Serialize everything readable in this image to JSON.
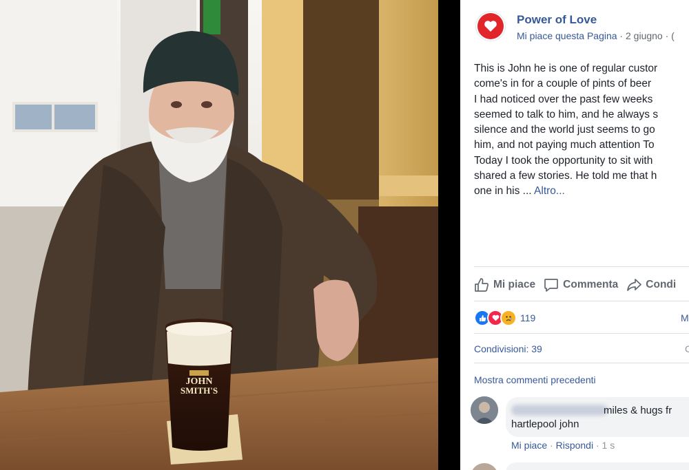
{
  "post": {
    "page_name": "Power of Love",
    "like_page": "Mi piace questa Pagina",
    "separator": " · ",
    "date": "2 giugno",
    "date_tail": " · (",
    "text_lines": [
      "This is John he is one of regular custor",
      "come's in for a couple of pints of beer",
      "I had noticed over the past few weeks",
      "seemed to talk to him, and he always s",
      "silence and the world just seems to go",
      "him, and not paying much attention To",
      "Today I took the opportunity to sit with",
      "shared a few stories. He told me that h"
    ],
    "last_line_prefix": "one in his ... ",
    "more_label": "Altro..."
  },
  "actions": {
    "like": "Mi piace",
    "comment": "Commenta",
    "share": "Condi"
  },
  "reactions": {
    "count": "119",
    "right_link": "M",
    "shares": "Condivisioni: 39",
    "shares_right": "C"
  },
  "comments": {
    "previous_label": "Mostra commenti precedenti",
    "items": [
      {
        "text_line1": "miles & hugs fr",
        "text_line2": "hartlepool john",
        "like_label": "Mi piace",
        "dot": " · ",
        "reply_label": "Rispondi",
        "time": " · 1 s"
      }
    ]
  },
  "photo": {
    "glass_brand_line1": "JOHN",
    "glass_brand_line2": "SMITH'S"
  },
  "colors": {
    "link": "#365899",
    "page_icon": "#e0262b",
    "like_reaction": "#1877f2",
    "love_reaction": "#f0284a",
    "sad_reaction": "#f7b125"
  },
  "icons": {
    "page_avatar": "heart-icon",
    "like": "thumbs-up-icon",
    "comment": "speech-bubble-icon",
    "share": "share-arrow-icon"
  }
}
